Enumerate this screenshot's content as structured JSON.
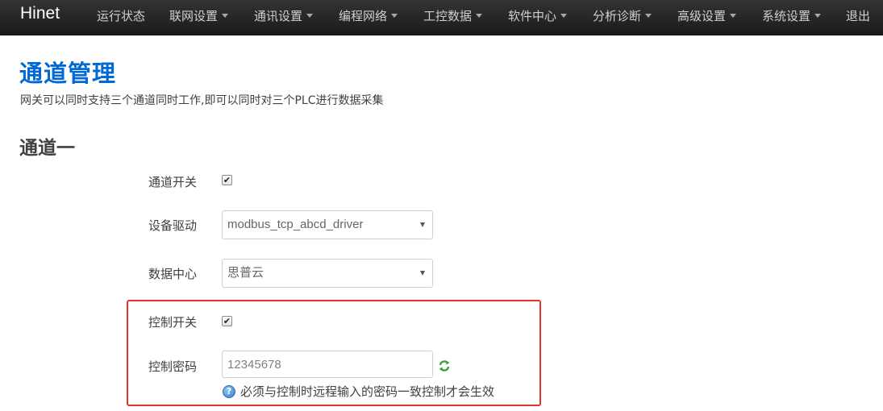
{
  "navbar": {
    "brand": "Hinet",
    "items": [
      {
        "label": "运行状态",
        "dropdown": false
      },
      {
        "label": "联网设置",
        "dropdown": true
      },
      {
        "label": "通讯设置",
        "dropdown": true
      },
      {
        "label": "编程网络",
        "dropdown": true
      },
      {
        "label": "工控数据",
        "dropdown": true
      },
      {
        "label": "软件中心",
        "dropdown": true
      },
      {
        "label": "分析诊断",
        "dropdown": true
      },
      {
        "label": "高级设置",
        "dropdown": true
      },
      {
        "label": "系统设置",
        "dropdown": true
      },
      {
        "label": "退出",
        "dropdown": false
      }
    ]
  },
  "page": {
    "title": "通道管理",
    "description": "网关可以同时支持三个通道同时工作,即可以同时对三个PLC进行数据采集"
  },
  "channel1": {
    "title": "通道一",
    "channel_switch": {
      "label": "通道开关",
      "checked": true
    },
    "device_driver": {
      "label": "设备驱动",
      "value": "modbus_tcp_abcd_driver"
    },
    "data_center": {
      "label": "数据中心",
      "value": "思普云"
    },
    "control_switch": {
      "label": "控制开关",
      "checked": true
    },
    "control_password": {
      "label": "控制密码",
      "value": "12345678",
      "hint": "必须与控制时远程输入的密码一致控制才会生效"
    }
  },
  "colors": {
    "navbar_bg": "#222222",
    "title_blue": "#0069d6",
    "highlight_red": "#e8332a",
    "refresh_green": "#3ea33a"
  }
}
